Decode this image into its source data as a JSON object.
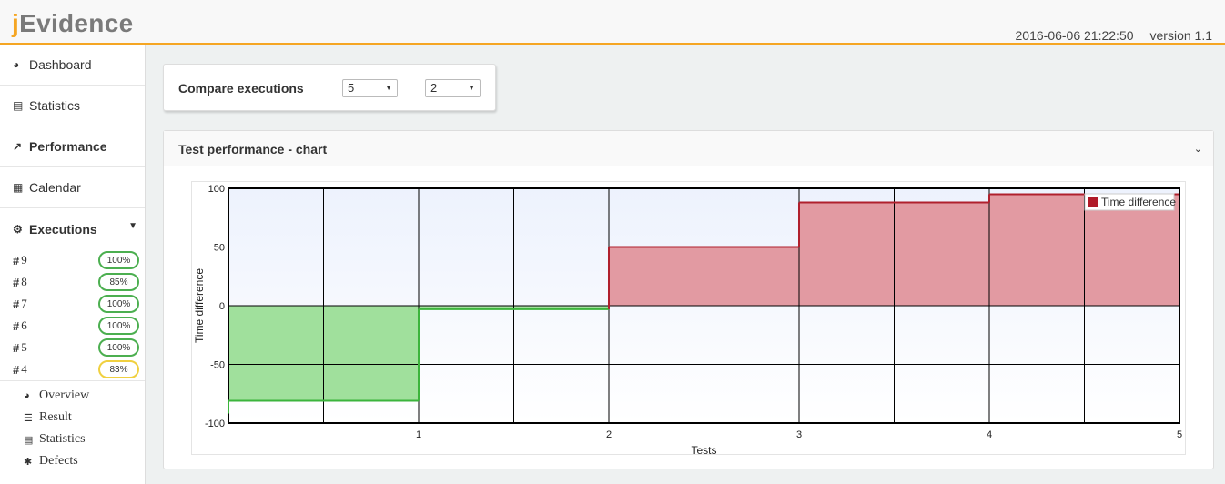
{
  "app": {
    "logo_j": "j",
    "logo_rest": "Evidence",
    "datetime": "2016-06-06 21:22:50",
    "version": "version 1.1"
  },
  "sidebar": {
    "items": [
      {
        "icon": "dashboard-icon",
        "label": "Dashboard"
      },
      {
        "icon": "bar-chart-icon",
        "label": "Statistics"
      },
      {
        "icon": "line-chart-icon",
        "label": "Performance"
      },
      {
        "icon": "calendar-icon",
        "label": "Calendar"
      },
      {
        "icon": "gears-icon",
        "label": "Executions"
      }
    ],
    "executions": [
      {
        "num": "9",
        "pct": "100%"
      },
      {
        "num": "8",
        "pct": "85%"
      },
      {
        "num": "7",
        "pct": "100%"
      },
      {
        "num": "6",
        "pct": "100%"
      },
      {
        "num": "5",
        "pct": "100%"
      },
      {
        "num": "4",
        "pct": "83%"
      }
    ],
    "subitems": [
      {
        "icon": "dashboard-icon",
        "label": "Overview"
      },
      {
        "icon": "list-icon",
        "label": "Result"
      },
      {
        "icon": "bar-chart-icon",
        "label": "Statistics"
      },
      {
        "icon": "bug-icon",
        "label": "Defects"
      }
    ]
  },
  "compare": {
    "label": "Compare executions",
    "select_a": "5",
    "select_b": "2"
  },
  "chart_panel": {
    "title": "Test performance - chart"
  },
  "chart_data": {
    "type": "area",
    "xlabel": "Tests",
    "ylabel": "Time difference",
    "xlim": [
      0,
      5
    ],
    "ylim": [
      -100,
      100
    ],
    "xticks": [
      "1",
      "2",
      "3",
      "4",
      "5"
    ],
    "yticks": [
      "100",
      "50",
      "0",
      "-50",
      "-100"
    ],
    "legend": "top-right",
    "grid": true,
    "series": [
      {
        "name": "Time difference",
        "step": true,
        "x": [
          0,
          1,
          2,
          3,
          4,
          5
        ],
        "y": [
          -81,
          -3,
          50,
          88,
          95,
          95
        ]
      }
    ],
    "colors": {
      "positive_fill": "#e29aa2",
      "positive_line": "#b0202d",
      "negative_fill": "#a0e09c",
      "negative_line": "#3cb43c",
      "legend_swatch": "#b01a28"
    }
  }
}
